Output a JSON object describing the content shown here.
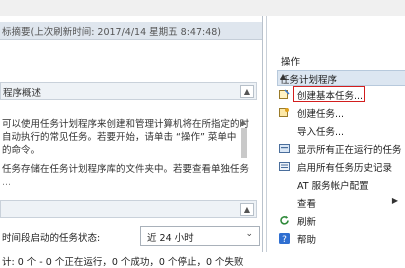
{
  "left": {
    "header": "标摘要(上次刷新时间: 2017/4/14 星期五 8:47:48)",
    "overview_title": "程序概述",
    "body_lines": [
      "可以使用任务计划程序来创建和管理计算机将在所指定的时",
      "自动执行的常见任务。若要开始，请单击 “操作” 菜单中",
      "的命令。",
      "任务存储在任务计划程序库的文件夹中。若要查看单独任务",
      "..."
    ],
    "status_label": "时间段启动的任务状态:",
    "status_value": "近 24 小时",
    "summary": "计: 0 个 - 0 个正在运行，0 个成功，0 个停止，0 个失败"
  },
  "right": {
    "header": "操作",
    "section_title": "任务计划程序",
    "items": [
      {
        "label": "创建基本任务...",
        "icon": "create-basic-task-icon"
      },
      {
        "label": "创建任务...",
        "icon": "create-task-icon"
      },
      {
        "label": "导入任务...",
        "icon": "import-task-icon"
      },
      {
        "label": "显示所有正在运行的任务",
        "icon": "running-tasks-icon"
      },
      {
        "label": "启用所有任务历史记录",
        "icon": "task-history-icon"
      },
      {
        "label": "AT 服务帐户配置",
        "icon": "at-service-icon"
      },
      {
        "label": "查看",
        "icon": "view-icon"
      },
      {
        "label": "刷新",
        "icon": "refresh-icon"
      },
      {
        "label": "帮助",
        "icon": "help-icon"
      }
    ]
  },
  "colors": {
    "highlight": "#d21e1e",
    "section_bg": "#dce6f1"
  }
}
